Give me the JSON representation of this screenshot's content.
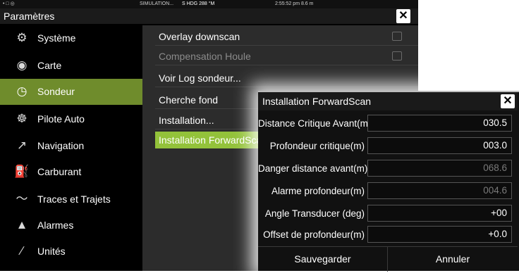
{
  "status": {
    "icons": "• □ ◎",
    "simulation": "SIMULATION...",
    "heading": "S HDG 288 °M",
    "time": "2:55:52 pm  8.6 m"
  },
  "header": {
    "title": "Paramètres",
    "close": "✕"
  },
  "sidebar": {
    "items": [
      {
        "label": "Système",
        "icon": "⚙",
        "icon_name": "gear-icon"
      },
      {
        "label": "Carte",
        "icon": "◉",
        "icon_name": "globe-icon"
      },
      {
        "label": "Sondeur",
        "icon": "◷",
        "icon_name": "sonar-icon"
      },
      {
        "label": "Pilote Auto",
        "icon": "☸",
        "icon_name": "helm-icon"
      },
      {
        "label": "Navigation",
        "icon": "↗",
        "icon_name": "compass-icon"
      },
      {
        "label": "Carburant",
        "icon": "⛽",
        "icon_name": "fuel-icon"
      },
      {
        "label": "Traces et Trajets",
        "icon": "〜",
        "icon_name": "track-icon"
      },
      {
        "label": "Alarmes",
        "icon": "▲",
        "icon_name": "bell-icon"
      },
      {
        "label": "Unités",
        "icon": "∕",
        "icon_name": "units-icon"
      }
    ],
    "active_index": 2
  },
  "content": {
    "rows": [
      {
        "label": "Overlay downscan",
        "checkbox": true,
        "checked": false,
        "dim": false
      },
      {
        "label": "Compensation Houle",
        "checkbox": true,
        "checked": false,
        "dim": true
      },
      {
        "label": "Voir Log sondeur...",
        "checkbox": false,
        "dim": false
      },
      {
        "label": "Cherche fond",
        "checkbox": false,
        "dim": false
      },
      {
        "label": "Installation...",
        "checkbox": false,
        "dim": false
      },
      {
        "label": "Installation ForwardScan...",
        "checkbox": false,
        "dim": false
      }
    ],
    "active_index": 5
  },
  "dialog": {
    "title": "Installation ForwardScan",
    "close": "✕",
    "fields": [
      {
        "label": "Distance Critique Avant(m)",
        "value": "030.5",
        "dim": false
      },
      {
        "label": "Profondeur critique(m)",
        "value": "003.0",
        "dim": false
      },
      {
        "label": "Danger distance avant(m)",
        "value": "068.6",
        "dim": true
      },
      {
        "label": "Alarme profondeur(m)",
        "value": "004.6",
        "dim": true
      },
      {
        "label": "Angle Transducer (deg)",
        "value": "+00",
        "dim": false
      },
      {
        "label": "Offset de profondeur(m)",
        "value": "+0.0",
        "dim": false
      }
    ],
    "save_label": "Sauvegarder",
    "cancel_label": "Annuler"
  },
  "colors": {
    "sidebar_active": "#6f8c2c",
    "row_active": "#93c23a",
    "content_bg": "#2c2c2c"
  }
}
